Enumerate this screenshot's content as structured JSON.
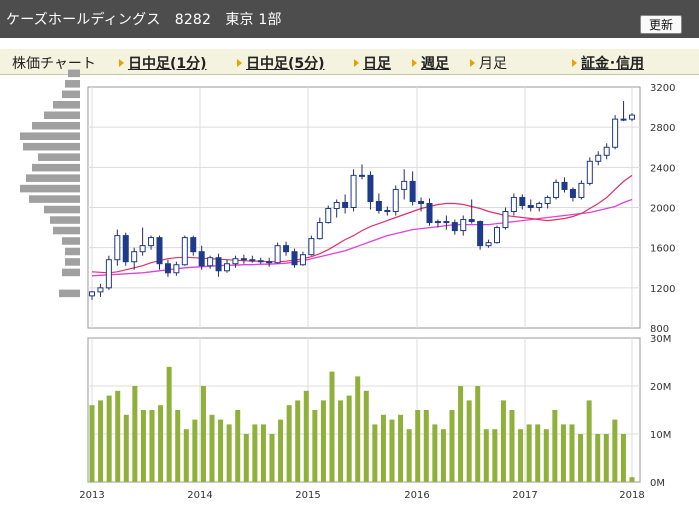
{
  "header": {
    "title": "ケーズホールディングス　8282　東京 1部",
    "refresh_label": "更新"
  },
  "tabs": [
    {
      "label": "株価チャート",
      "link": false,
      "marker": false
    },
    {
      "label": "日中足(1分)",
      "link": true,
      "marker": true
    },
    {
      "label": "日中足(5分)",
      "link": true,
      "marker": true
    },
    {
      "label": "日足",
      "link": true,
      "marker": true
    },
    {
      "label": "週足",
      "link": true,
      "marker": true
    },
    {
      "label": "月足",
      "link": false,
      "marker": true
    },
    {
      "label": "証金･信用",
      "link": true,
      "marker": true
    }
  ],
  "colors": {
    "up": "#ffffff",
    "down": "#1e3a8a",
    "ma_short": "#e0306a",
    "ma_long": "#e040e0",
    "volume": "#8fb03a",
    "profile": "#a0a0a0"
  },
  "chart_data": [
    {
      "type": "candlestick",
      "name": "price",
      "ylim": [
        800,
        3200
      ],
      "yticks": [
        800,
        1200,
        1600,
        2000,
        2400,
        2800,
        3200
      ],
      "ytick_labels": [
        "800",
        "1200",
        "1600",
        "2000",
        "2400",
        "2800",
        "3200"
      ],
      "xticks": [
        "2013",
        "2014",
        "2015",
        "2016",
        "2017",
        "2018"
      ],
      "ohlc": [
        [
          1120,
          1170,
          1080,
          1160
        ],
        [
          1160,
          1240,
          1110,
          1200
        ],
        [
          1200,
          1520,
          1180,
          1480
        ],
        [
          1480,
          1780,
          1420,
          1720
        ],
        [
          1720,
          1750,
          1420,
          1460
        ],
        [
          1460,
          1600,
          1380,
          1560
        ],
        [
          1560,
          1800,
          1520,
          1620
        ],
        [
          1620,
          1720,
          1580,
          1700
        ],
        [
          1700,
          1720,
          1380,
          1440
        ],
        [
          1440,
          1480,
          1310,
          1350
        ],
        [
          1350,
          1460,
          1320,
          1430
        ],
        [
          1430,
          1720,
          1420,
          1700
        ],
        [
          1700,
          1720,
          1520,
          1560
        ],
        [
          1560,
          1620,
          1380,
          1420
        ],
        [
          1420,
          1520,
          1390,
          1500
        ],
        [
          1500,
          1540,
          1310,
          1370
        ],
        [
          1370,
          1480,
          1350,
          1440
        ],
        [
          1440,
          1520,
          1400,
          1490
        ],
        [
          1490,
          1530,
          1440,
          1480
        ],
        [
          1480,
          1520,
          1450,
          1470
        ],
        [
          1470,
          1500,
          1440,
          1460
        ],
        [
          1460,
          1500,
          1410,
          1450
        ],
        [
          1450,
          1650,
          1440,
          1620
        ],
        [
          1620,
          1660,
          1520,
          1560
        ],
        [
          1560,
          1590,
          1400,
          1430
        ],
        [
          1430,
          1560,
          1420,
          1530
        ],
        [
          1530,
          1720,
          1520,
          1690
        ],
        [
          1690,
          1900,
          1680,
          1850
        ],
        [
          1850,
          2020,
          1840,
          1990
        ],
        [
          1990,
          2080,
          1900,
          2050
        ],
        [
          2050,
          2130,
          1940,
          2000
        ],
        [
          2000,
          2380,
          1960,
          2320
        ],
        [
          2320,
          2430,
          2280,
          2320
        ],
        [
          2320,
          2360,
          1980,
          2060
        ],
        [
          2060,
          2140,
          1940,
          1970
        ],
        [
          1970,
          2010,
          1920,
          1960
        ],
        [
          1960,
          2220,
          1920,
          2180
        ],
        [
          2180,
          2380,
          2080,
          2260
        ],
        [
          2260,
          2360,
          2020,
          2060
        ],
        [
          2060,
          2100,
          1960,
          2040
        ],
        [
          2040,
          2090,
          1820,
          1850
        ],
        [
          1850,
          1880,
          1800,
          1860
        ],
        [
          1860,
          1920,
          1780,
          1850
        ],
        [
          1850,
          1880,
          1730,
          1770
        ],
        [
          1770,
          1920,
          1720,
          1880
        ],
        [
          1880,
          2080,
          1840,
          1860
        ],
        [
          1860,
          1870,
          1580,
          1620
        ],
        [
          1620,
          1680,
          1600,
          1650
        ],
        [
          1650,
          1820,
          1640,
          1800
        ],
        [
          1800,
          2000,
          1780,
          1960
        ],
        [
          1960,
          2140,
          1920,
          2100
        ],
        [
          2100,
          2130,
          1980,
          2020
        ],
        [
          2020,
          2080,
          1960,
          2000
        ],
        [
          2000,
          2060,
          1960,
          2040
        ],
        [
          2040,
          2120,
          1990,
          2100
        ],
        [
          2100,
          2280,
          2080,
          2250
        ],
        [
          2250,
          2300,
          2150,
          2180
        ],
        [
          2180,
          2200,
          2060,
          2100
        ],
        [
          2100,
          2270,
          2080,
          2240
        ],
        [
          2240,
          2500,
          2220,
          2460
        ],
        [
          2460,
          2560,
          2420,
          2520
        ],
        [
          2520,
          2640,
          2480,
          2600
        ],
        [
          2600,
          2920,
          2580,
          2880
        ],
        [
          2880,
          3060,
          2860,
          2880
        ],
        [
          2880,
          2940,
          2860,
          2920
        ]
      ],
      "ma_short": [
        1360,
        1355,
        1350,
        1360,
        1380,
        1400,
        1420,
        1450,
        1470,
        1490,
        1500,
        1505,
        1500,
        1495,
        1490,
        1485,
        1480,
        1475,
        1470,
        1465,
        1465,
        1460,
        1460,
        1465,
        1475,
        1490,
        1510,
        1540,
        1580,
        1630,
        1680,
        1720,
        1770,
        1810,
        1840,
        1870,
        1900,
        1930,
        1960,
        1990,
        2010,
        2030,
        2040,
        2040,
        2030,
        2010,
        1990,
        1960,
        1940,
        1920,
        1910,
        1900,
        1890,
        1880,
        1870,
        1880,
        1890,
        1910,
        1940,
        1990,
        2040,
        2100,
        2180,
        2260,
        2320
      ],
      "ma_long": [
        1320,
        1325,
        1330,
        1335,
        1340,
        1345,
        1350,
        1360,
        1370,
        1380,
        1390,
        1400,
        1405,
        1410,
        1415,
        1420,
        1425,
        1425,
        1430,
        1430,
        1435,
        1435,
        1440,
        1445,
        1455,
        1470,
        1490,
        1510,
        1530,
        1550,
        1570,
        1600,
        1630,
        1660,
        1690,
        1720,
        1740,
        1760,
        1780,
        1790,
        1800,
        1810,
        1820,
        1830,
        1830,
        1830,
        1830,
        1830,
        1840,
        1850,
        1860,
        1870,
        1880,
        1890,
        1900,
        1910,
        1920,
        1930,
        1940,
        1950,
        1970,
        1990,
        2010,
        2050,
        2080
      ],
      "volume_profile": [
        0.35,
        0,
        0.3,
        0.25,
        0.25,
        0.3,
        0.45,
        0.5,
        0.6,
        0.85,
        1.0,
        0.9,
        0.8,
        0.7,
        0.95,
        1.0,
        0.8,
        0.6,
        0.45,
        0.3,
        0.25,
        0.2
      ]
    },
    {
      "type": "bar",
      "name": "volume",
      "ylim": [
        0,
        30000000
      ],
      "yticks": [
        0,
        10000000,
        20000000,
        30000000
      ],
      "ytick_labels": [
        "0M",
        "10M",
        "20M",
        "30M"
      ],
      "values": [
        16,
        17,
        18,
        19,
        14,
        20,
        15,
        15,
        16,
        24,
        15,
        11,
        13,
        20,
        14,
        13,
        12,
        15,
        10,
        12,
        12,
        10,
        13,
        16,
        17,
        19,
        15,
        17,
        23,
        17,
        18,
        22,
        19,
        12,
        14,
        13,
        14,
        11,
        15,
        15,
        12,
        11,
        15,
        20,
        17,
        20,
        11,
        11,
        17,
        15,
        11,
        12,
        12,
        11,
        15,
        12,
        12,
        10,
        17,
        10,
        10,
        13,
        10,
        1
      ]
    }
  ]
}
